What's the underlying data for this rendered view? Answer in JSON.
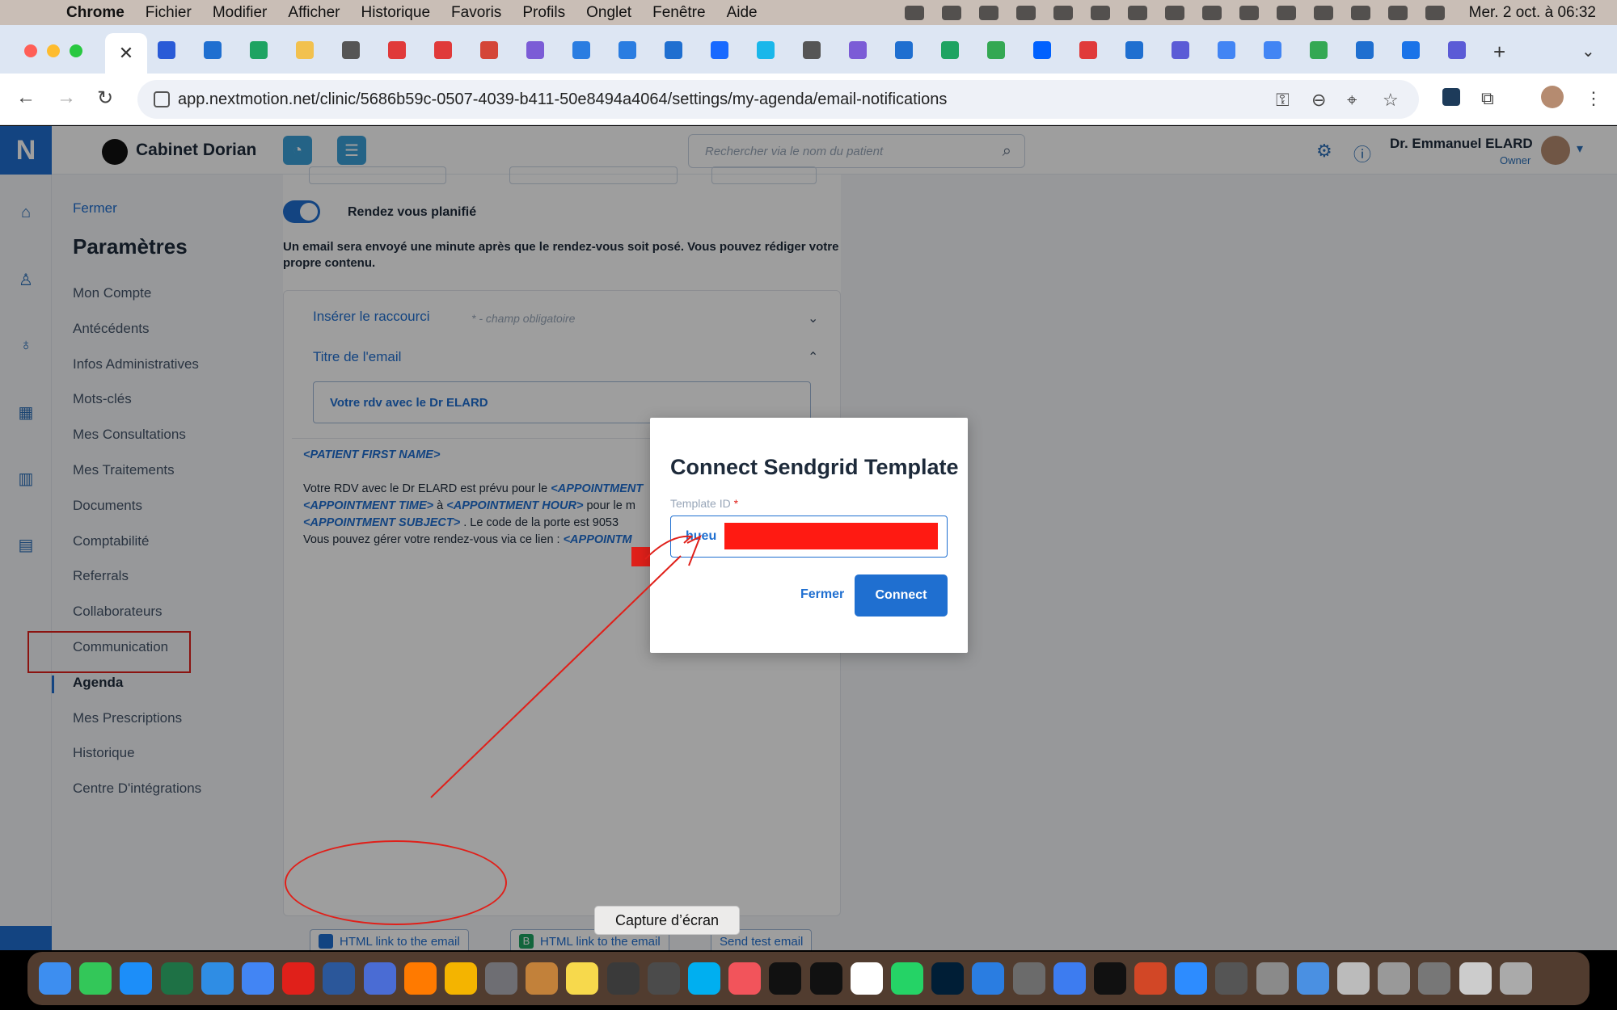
{
  "menubar": {
    "app": "Chrome",
    "items": [
      "Fichier",
      "Modifier",
      "Afficher",
      "Historique",
      "Favoris",
      "Profils",
      "Onglet",
      "Fenêtre",
      "Aide"
    ],
    "clock": "Mer. 2 oct. à 06:32"
  },
  "browser": {
    "url": "app.nextmotion.net/clinic/5686b59c-0507-4039-b411-50e8494a4064/settings/my-agenda/email-notifications",
    "favicon_colors": [
      "#2a5bd7",
      "#1f6fd0",
      "#1ea362",
      "#f2c14e",
      "#555555",
      "#e03a3a",
      "#e03a3a",
      "#d44638",
      "#7b5cd6",
      "#2a7de1",
      "#2a7de1",
      "#1f6fd0",
      "#1769ff",
      "#1ab7ea",
      "#555555",
      "#7b5cd6",
      "#1f6fd0",
      "#1ea362",
      "#34a853",
      "#0061fe",
      "#e03a3a",
      "#1f6fd0",
      "#5b5bd6",
      "#4285f4",
      "#4285f4",
      "#34a853",
      "#1f6fd0",
      "#1a73e8",
      "#5b5bd6"
    ]
  },
  "header": {
    "brand": "N",
    "clinic_name": "Cabinet Dorian",
    "search_placeholder": "Rechercher via le nom du patient",
    "user_name": "Dr. Emmanuel ELARD",
    "user_role": "Owner"
  },
  "settings": {
    "close_link": "Fermer",
    "title": "Paramètres",
    "items": [
      "Mon Compte",
      "Antécédents",
      "Infos Administratives",
      "Mots-clés",
      "Mes Consultations",
      "Mes Traitements",
      "Documents",
      "Comptabilité",
      "Referrals",
      "Collaborateurs",
      "Communication",
      "Agenda",
      "Mes Prescriptions",
      "Historique",
      "Centre D'intégrations"
    ],
    "active": "Agenda"
  },
  "email_settings": {
    "toggle_label": "Rendez vous planifié",
    "toggle_on": true,
    "description": "Un email sera envoyé une minute après que le rendez-vous soit posé. Vous pouvez rédiger votre propre contenu.",
    "shortcut_label": "Insérer le raccourci",
    "required_hint": "* - champ obligatoire",
    "subject_label": "Titre de l'email",
    "subject_value": "Votre rdv avec le Dr ELARD",
    "body": {
      "line1_tag": "<PATIENT FIRST NAME>",
      "line2_text": "Votre RDV avec le Dr ELARD est prévu pour le ",
      "line2_tag": "<APPOINTMENT",
      "line3_tag_a": "<APPOINTMENT TIME>",
      "line3_text_a": " à ",
      "line3_tag_b": "<APPOINTMENT HOUR>",
      "line3_text_b": " pour le m",
      "line4_tag": "<APPOINTMENT SUBJECT>",
      "line4_text": " . Le code de la porte est 9053",
      "line5_text": "Vous pouvez gérer votre rendez-vous via ce lien : ",
      "line5_tag": "<APPOINTM"
    },
    "buttons": {
      "html_link_1": "HTML link to the email",
      "html_link_2": "HTML link to the email",
      "send_test": "Send test email"
    }
  },
  "modal": {
    "title": "Connect Sendgrid Template",
    "field_label": "Template ID",
    "required_mark": "*",
    "field_value": "hueu",
    "close_label": "Fermer",
    "connect_label": "Connect"
  },
  "tooltip": "Capture d’écran",
  "dock": {
    "app_colors": [
      "#3d8ef0",
      "#33c759",
      "#1c8ef9",
      "#1e7145",
      "#2f8de4",
      "#4285f4",
      "#e0201a",
      "#2b579a",
      "#4a6cd4",
      "#ff7a00",
      "#f4b400",
      "#6e6e73",
      "#c2813a",
      "#f7d94c",
      "#3a3a3a",
      "#4b4b4b",
      "#00aff0",
      "#f2545b",
      "#111111",
      "#111111",
      "#ffffff",
      "#25d366",
      "#001e36",
      "#2a7de1",
      "#6b6b6b",
      "#3d7cf0",
      "#111111",
      "#d24726",
      "#2d8cff",
      "#555555",
      "#8a8a8a",
      "#4a90e2",
      "#bbbbbb",
      "#999999",
      "#777777",
      "#cccccc",
      "#aaaaaa"
    ]
  }
}
